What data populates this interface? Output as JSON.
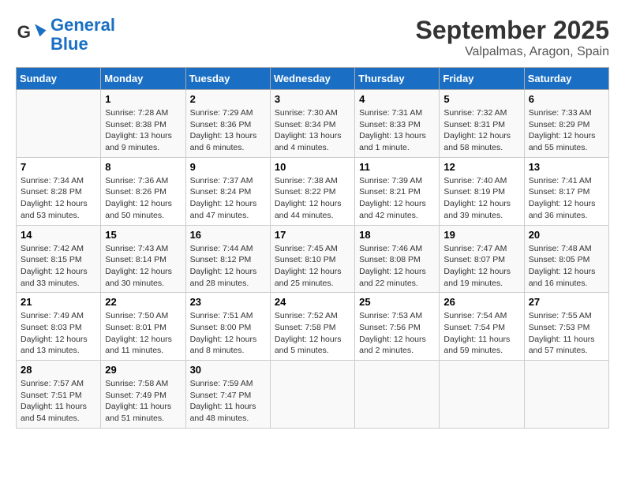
{
  "header": {
    "logo_line1": "General",
    "logo_line2": "Blue",
    "month": "September 2025",
    "location": "Valpalmas, Aragon, Spain"
  },
  "weekdays": [
    "Sunday",
    "Monday",
    "Tuesday",
    "Wednesday",
    "Thursday",
    "Friday",
    "Saturday"
  ],
  "weeks": [
    [
      {
        "day": "",
        "info": ""
      },
      {
        "day": "1",
        "info": "Sunrise: 7:28 AM\nSunset: 8:38 PM\nDaylight: 13 hours\nand 9 minutes."
      },
      {
        "day": "2",
        "info": "Sunrise: 7:29 AM\nSunset: 8:36 PM\nDaylight: 13 hours\nand 6 minutes."
      },
      {
        "day": "3",
        "info": "Sunrise: 7:30 AM\nSunset: 8:34 PM\nDaylight: 13 hours\nand 4 minutes."
      },
      {
        "day": "4",
        "info": "Sunrise: 7:31 AM\nSunset: 8:33 PM\nDaylight: 13 hours\nand 1 minute."
      },
      {
        "day": "5",
        "info": "Sunrise: 7:32 AM\nSunset: 8:31 PM\nDaylight: 12 hours\nand 58 minutes."
      },
      {
        "day": "6",
        "info": "Sunrise: 7:33 AM\nSunset: 8:29 PM\nDaylight: 12 hours\nand 55 minutes."
      }
    ],
    [
      {
        "day": "7",
        "info": "Sunrise: 7:34 AM\nSunset: 8:28 PM\nDaylight: 12 hours\nand 53 minutes."
      },
      {
        "day": "8",
        "info": "Sunrise: 7:36 AM\nSunset: 8:26 PM\nDaylight: 12 hours\nand 50 minutes."
      },
      {
        "day": "9",
        "info": "Sunrise: 7:37 AM\nSunset: 8:24 PM\nDaylight: 12 hours\nand 47 minutes."
      },
      {
        "day": "10",
        "info": "Sunrise: 7:38 AM\nSunset: 8:22 PM\nDaylight: 12 hours\nand 44 minutes."
      },
      {
        "day": "11",
        "info": "Sunrise: 7:39 AM\nSunset: 8:21 PM\nDaylight: 12 hours\nand 42 minutes."
      },
      {
        "day": "12",
        "info": "Sunrise: 7:40 AM\nSunset: 8:19 PM\nDaylight: 12 hours\nand 39 minutes."
      },
      {
        "day": "13",
        "info": "Sunrise: 7:41 AM\nSunset: 8:17 PM\nDaylight: 12 hours\nand 36 minutes."
      }
    ],
    [
      {
        "day": "14",
        "info": "Sunrise: 7:42 AM\nSunset: 8:15 PM\nDaylight: 12 hours\nand 33 minutes."
      },
      {
        "day": "15",
        "info": "Sunrise: 7:43 AM\nSunset: 8:14 PM\nDaylight: 12 hours\nand 30 minutes."
      },
      {
        "day": "16",
        "info": "Sunrise: 7:44 AM\nSunset: 8:12 PM\nDaylight: 12 hours\nand 28 minutes."
      },
      {
        "day": "17",
        "info": "Sunrise: 7:45 AM\nSunset: 8:10 PM\nDaylight: 12 hours\nand 25 minutes."
      },
      {
        "day": "18",
        "info": "Sunrise: 7:46 AM\nSunset: 8:08 PM\nDaylight: 12 hours\nand 22 minutes."
      },
      {
        "day": "19",
        "info": "Sunrise: 7:47 AM\nSunset: 8:07 PM\nDaylight: 12 hours\nand 19 minutes."
      },
      {
        "day": "20",
        "info": "Sunrise: 7:48 AM\nSunset: 8:05 PM\nDaylight: 12 hours\nand 16 minutes."
      }
    ],
    [
      {
        "day": "21",
        "info": "Sunrise: 7:49 AM\nSunset: 8:03 PM\nDaylight: 12 hours\nand 13 minutes."
      },
      {
        "day": "22",
        "info": "Sunrise: 7:50 AM\nSunset: 8:01 PM\nDaylight: 12 hours\nand 11 minutes."
      },
      {
        "day": "23",
        "info": "Sunrise: 7:51 AM\nSunset: 8:00 PM\nDaylight: 12 hours\nand 8 minutes."
      },
      {
        "day": "24",
        "info": "Sunrise: 7:52 AM\nSunset: 7:58 PM\nDaylight: 12 hours\nand 5 minutes."
      },
      {
        "day": "25",
        "info": "Sunrise: 7:53 AM\nSunset: 7:56 PM\nDaylight: 12 hours\nand 2 minutes."
      },
      {
        "day": "26",
        "info": "Sunrise: 7:54 AM\nSunset: 7:54 PM\nDaylight: 11 hours\nand 59 minutes."
      },
      {
        "day": "27",
        "info": "Sunrise: 7:55 AM\nSunset: 7:53 PM\nDaylight: 11 hours\nand 57 minutes."
      }
    ],
    [
      {
        "day": "28",
        "info": "Sunrise: 7:57 AM\nSunset: 7:51 PM\nDaylight: 11 hours\nand 54 minutes."
      },
      {
        "day": "29",
        "info": "Sunrise: 7:58 AM\nSunset: 7:49 PM\nDaylight: 11 hours\nand 51 minutes."
      },
      {
        "day": "30",
        "info": "Sunrise: 7:59 AM\nSunset: 7:47 PM\nDaylight: 11 hours\nand 48 minutes."
      },
      {
        "day": "",
        "info": ""
      },
      {
        "day": "",
        "info": ""
      },
      {
        "day": "",
        "info": ""
      },
      {
        "day": "",
        "info": ""
      }
    ]
  ]
}
